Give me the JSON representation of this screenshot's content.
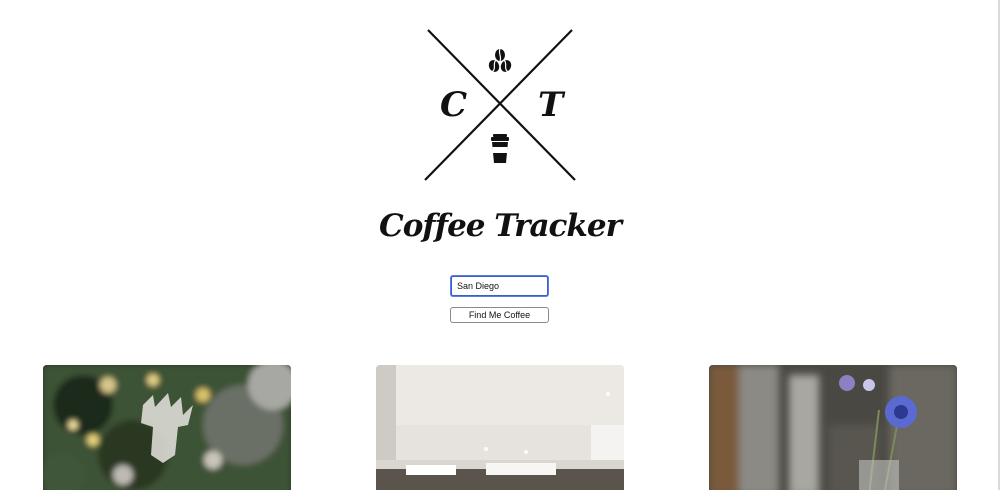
{
  "logo": {
    "letter_left": "C",
    "letter_right": "T",
    "top_icon": "coffee-bean-icon",
    "bottom_icon": "coffee-cup-icon"
  },
  "header": {
    "title": "Coffee Tracker"
  },
  "search": {
    "value": "San Diego"
  },
  "actions": {
    "find_label": "Find Me Coffee"
  },
  "results": {
    "cards": [
      {
        "image": "christmas-tree-photo"
      },
      {
        "image": "cafe-interior-photo"
      },
      {
        "image": "flower-vase-photo"
      }
    ]
  },
  "colors": {
    "text": "#111111",
    "input_focus": "#3a5fcd",
    "button_border": "#8a8a8a",
    "background": "#ffffff"
  }
}
